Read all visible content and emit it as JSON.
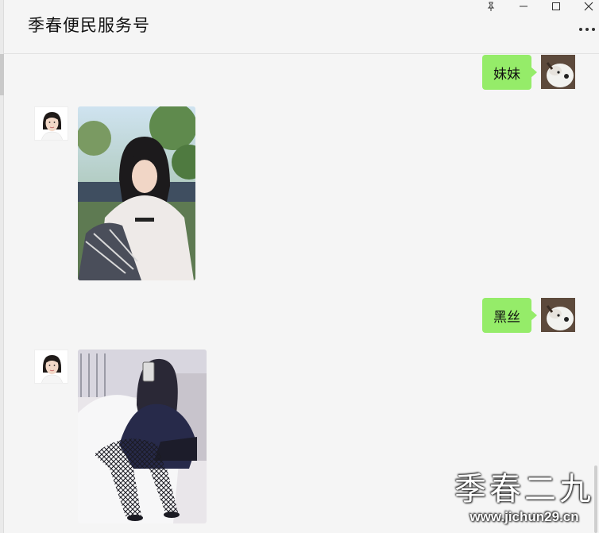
{
  "window": {
    "title": "季春便民服务号",
    "controls": {
      "pin_icon": "pin-icon",
      "minimize_icon": "minimize-icon",
      "maximize_icon": "maximize-icon",
      "close_icon": "close-icon",
      "more_icon": "more-icon"
    }
  },
  "messages": [
    {
      "sender": "me",
      "type": "text",
      "text": "妹妹"
    },
    {
      "sender": "bot",
      "type": "image",
      "image": "girl-white-sweater-photo"
    },
    {
      "sender": "me",
      "type": "text",
      "text": "黑丝"
    },
    {
      "sender": "bot",
      "type": "image",
      "image": "girl-black-stockings-photo"
    }
  ],
  "watermark": {
    "big": "季春二九",
    "small": "www.jichun29.cn"
  },
  "colors": {
    "background": "#f5f5f5",
    "bubble_me": "#95ec69"
  }
}
